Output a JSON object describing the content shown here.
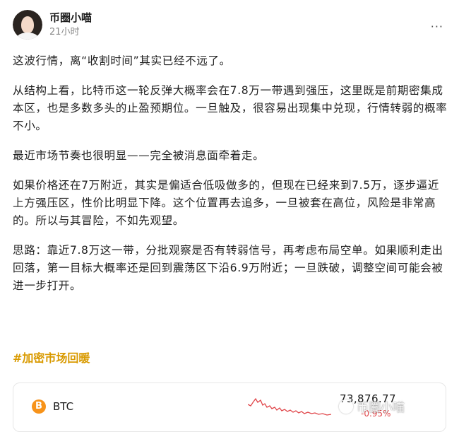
{
  "post": {
    "author": "币圈小喵",
    "time": "21小时",
    "more_label": "···",
    "paragraphs": [
      "这波行情，离“收割时间”其实已经不远了。",
      "从结构上看，比特币这一轮反弹大概率会在7.8万一带遇到强压，这里既是前期密集成本区，也是多数多头的止盈预期位。一旦触及，很容易出现集中兑现，行情转弱的概率不小。",
      "最近市场节奏也很明显——完全被消息面牵着走。",
      "如果价格还在7万附近，其实是偏适合低吸做多的，但现在已经来到7.5万，逐步逼近上方强压区，性价比明显下降。这个位置再去追多，一旦被套在高位，风险是非常高的。所以与其冒险，不如先观望。",
      "思路：靠近7.8万这一带，分批观察是否有转弱信号，再考虑布局空单。如果顺利走出回落，第一目标大概率还是回到震荡区下沿6.9万附近；一旦跌破，调整空间可能会被进一步打开。"
    ],
    "hashtag": "#加密市场回暖"
  },
  "ticker": {
    "icon_glyph": "B",
    "icon_color": "#f7931a",
    "symbol": "BTC",
    "price": "73,876.77",
    "change": "-0.95%",
    "change_color": "#e0464a"
  },
  "watermark": {
    "text": "币圈小喵",
    "icon": "watermark-logo-icon"
  }
}
